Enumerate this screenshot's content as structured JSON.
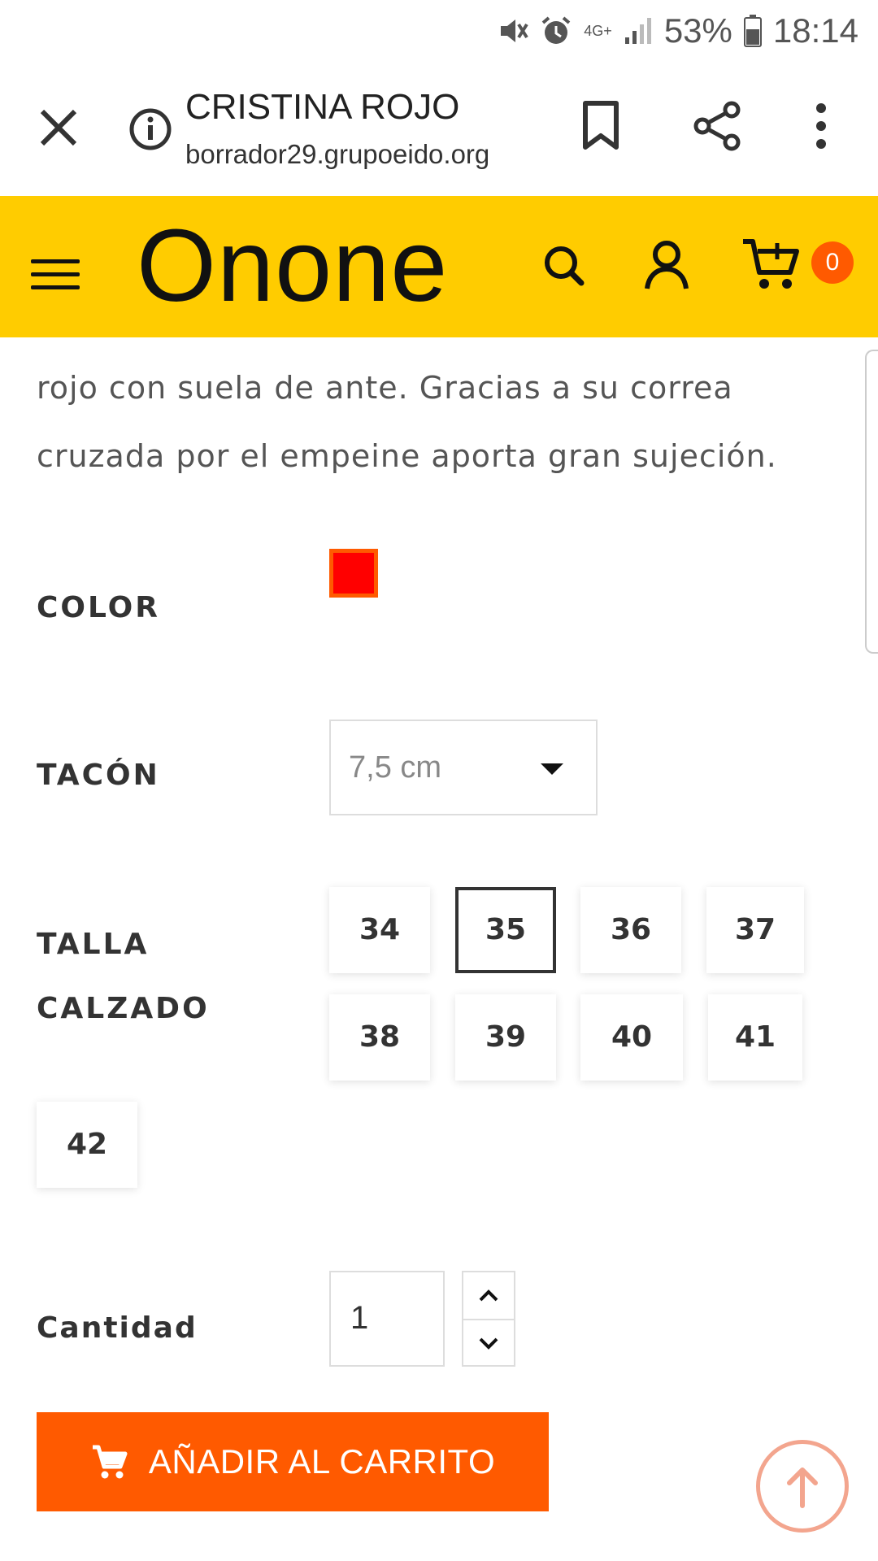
{
  "status_bar": {
    "battery_percent": "53%",
    "time": "18:14",
    "network": "4G+"
  },
  "browser": {
    "page_title": "CRISTINA ROJO",
    "url": "borrador29.grupoeido.org"
  },
  "header": {
    "logo": "Onone",
    "cart_count": "0"
  },
  "product": {
    "description": "rojo con suela de ante. Gracias a su correa cruzada por el empeine aporta gran sujeción.",
    "color_label": "COLOR",
    "color_value": "#ff0000",
    "heel_label": "TACÓN",
    "heel_value": "7,5 cm",
    "size_label_line1": "TALLA",
    "size_label_line2": "CALZADO",
    "sizes": [
      "34",
      "35",
      "36",
      "37",
      "38",
      "39",
      "40",
      "41",
      "42"
    ],
    "selected_size": "35",
    "quantity_label": "Cantidad",
    "quantity_value": "1",
    "add_to_cart": "AÑADIR AL CARRITO"
  },
  "colors": {
    "brand_yellow": "#ffcc00",
    "accent_orange": "#ff5a00"
  }
}
